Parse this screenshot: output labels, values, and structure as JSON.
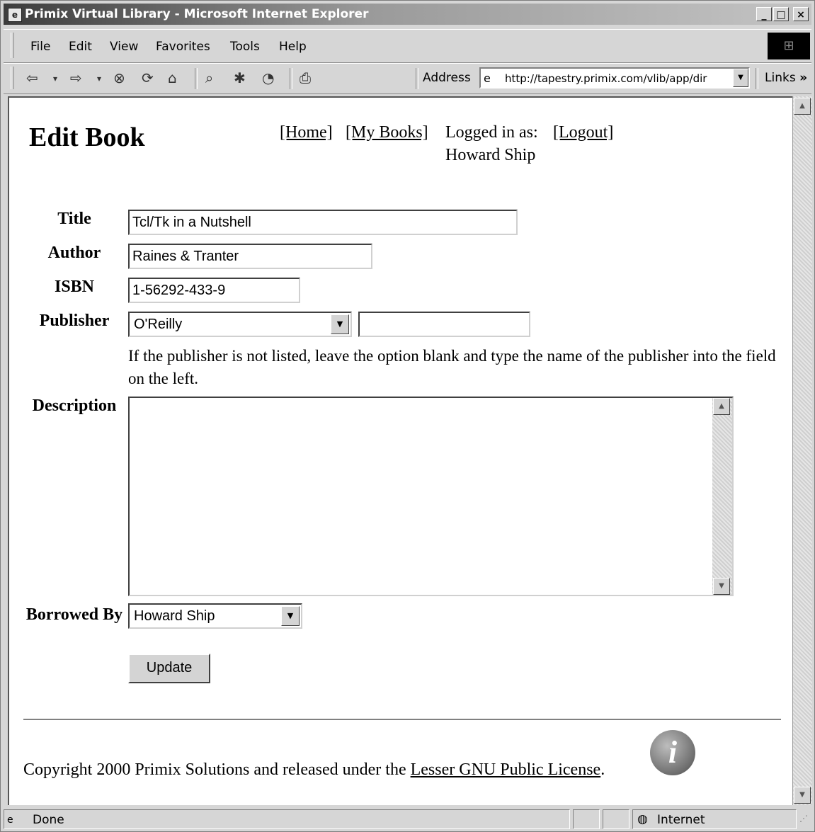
{
  "window": {
    "title": "Primix Virtual Library - Microsoft Internet Explorer",
    "controls": {
      "minimize": "_",
      "maximize": "□",
      "close": "×"
    }
  },
  "menubar": {
    "items": [
      "File",
      "Edit",
      "View",
      "Favorites",
      "Tools",
      "Help"
    ]
  },
  "toolbar": {
    "address_label": "Address",
    "url": "http://tapestry.primix.com/vlib/app/dir",
    "links_label": "Links"
  },
  "page": {
    "heading": "Edit Book",
    "nav": {
      "home": "[Home]",
      "my_books": "[My Books]",
      "logged_in_label": "Logged in as:",
      "logout": "[Logout]",
      "username": "Howard Ship"
    },
    "form": {
      "title_label": "Title",
      "title_value": "Tcl/Tk in a Nutshell",
      "author_label": "Author",
      "author_value": "Raines & Tranter",
      "isbn_label": "ISBN",
      "isbn_value": "1-56292-433-9",
      "publisher_label": "Publisher",
      "publisher_selected": "O'Reilly",
      "publisher_other_value": "",
      "publisher_help": "If the publisher is not listed, leave the option blank and type the name of the publisher into the field on the left.",
      "description_label": "Description",
      "description_value": "",
      "borrowed_label": "Borrowed By",
      "borrowed_selected": "Howard Ship",
      "update_button": "Update"
    },
    "footer": {
      "copyright_prefix": "Copyright 2000 Primix Solutions and released under the ",
      "license_link": "Lesser GNU Public License",
      "copyright_suffix": "."
    }
  },
  "statusbar": {
    "status": "Done",
    "zone": "Internet"
  },
  "icons": {
    "info_icon_glyph": "i"
  }
}
